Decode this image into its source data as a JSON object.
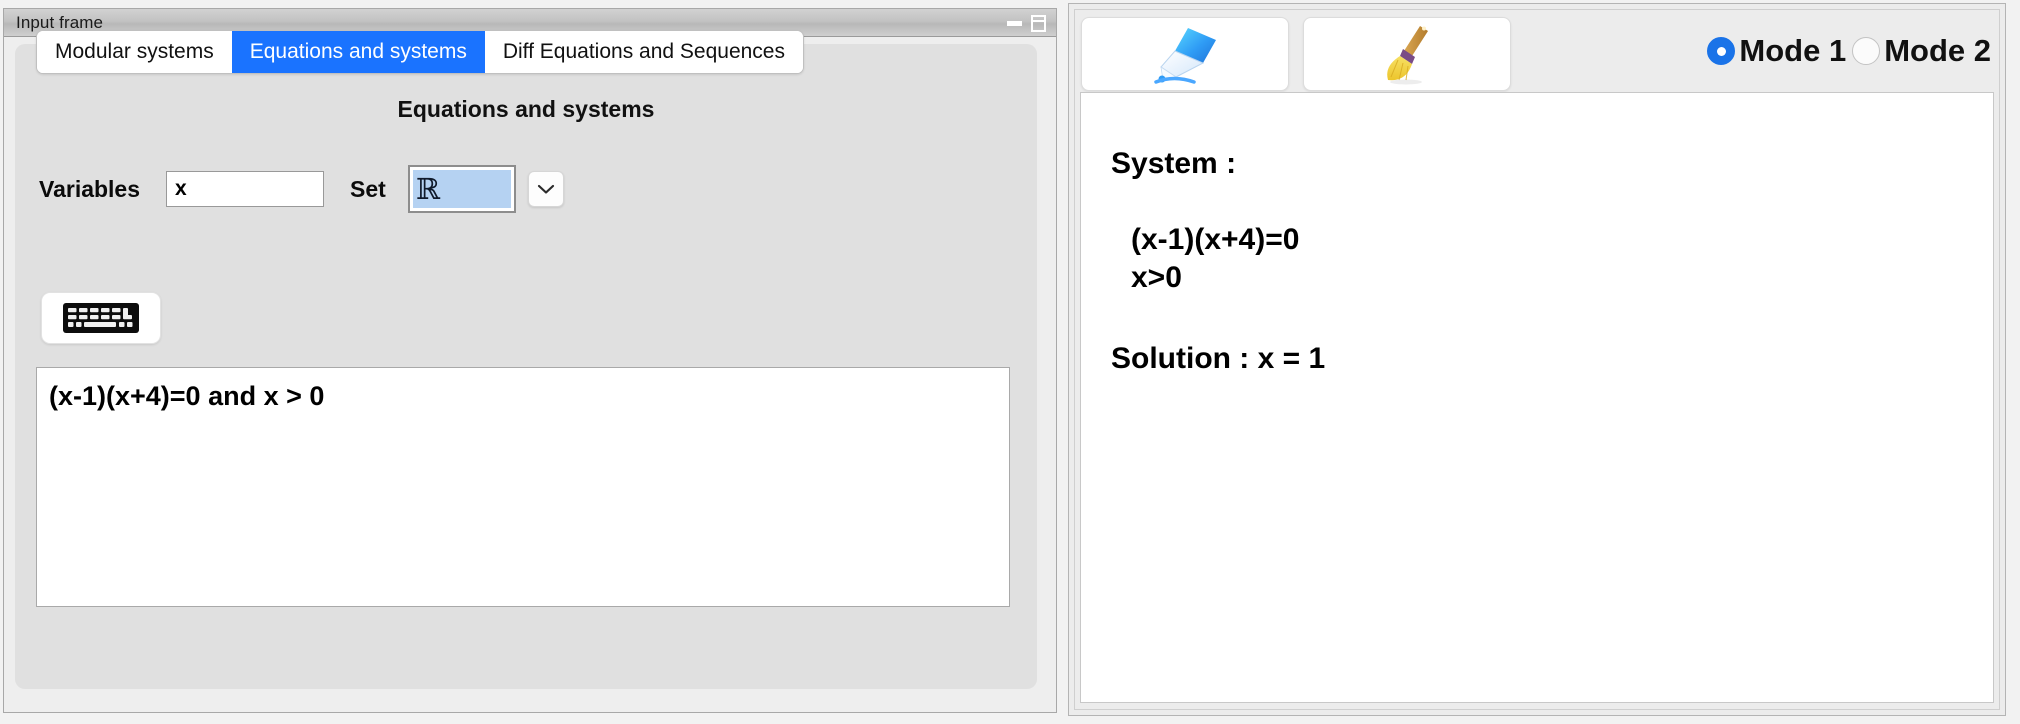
{
  "window": {
    "title": "Input frame",
    "controls": [
      {
        "name": "minimize",
        "glyph": "minimize-icon"
      },
      {
        "name": "maximize",
        "glyph": "maximize-icon"
      }
    ]
  },
  "tabs": [
    {
      "label": "Modular systems",
      "active": false
    },
    {
      "label": "Equations and systems",
      "active": true
    },
    {
      "label": "Diff Equations and Sequences",
      "active": false
    }
  ],
  "section": {
    "heading": "Equations and systems"
  },
  "form": {
    "variables_label": "Variables",
    "variables_value": "x",
    "variables_placeholder": "",
    "set_label": "Set",
    "set_value": "ℝ",
    "set_dropdown_icon": "chevron-down-icon",
    "keyboard_icon": "keyboard-icon"
  },
  "expression": {
    "value": "(x-1)(x+4)=0 and x > 0",
    "placeholder": ""
  },
  "toolbar": {
    "buttons": [
      {
        "name": "solve-button",
        "icon": "pen-icon",
        "label": ""
      },
      {
        "name": "clear-button",
        "icon": "broom-icon",
        "label": ""
      }
    ]
  },
  "modes": [
    {
      "label": "Mode 1",
      "selected": true
    },
    {
      "label": "Mode 2",
      "selected": false
    }
  ],
  "output": {
    "system_heading": "System :",
    "system_lines": [
      "(x-1)(x+4)=0",
      "x>0"
    ],
    "solution_line": "Solution : x = 1"
  },
  "colors": {
    "accent_tab": "#1a73ff",
    "accent_radio": "#1a73e8",
    "set_highlight": "#b5d2f2",
    "panel_gray": "#e0e0e0",
    "window_gray": "#eeeeee"
  }
}
